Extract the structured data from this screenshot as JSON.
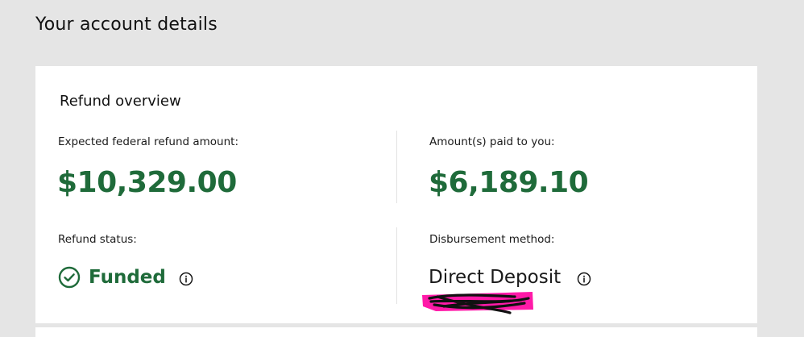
{
  "page": {
    "title": "Your account details"
  },
  "refund_overview": {
    "title": "Refund overview",
    "expected": {
      "label": "Expected federal refund amount:",
      "amount": "$10,329.00"
    },
    "paid": {
      "label": "Amount(s) paid to you:",
      "amount": "$6,189.10"
    },
    "status": {
      "label": "Refund status:",
      "value": "Funded",
      "icon": "check-circle-icon",
      "info_icon": "info-icon"
    },
    "disbursement": {
      "label": "Disbursement method:",
      "value": "Direct Deposit",
      "info_icon": "info-icon"
    }
  },
  "colors": {
    "page_background": "#e5e5e5",
    "card_background": "#ffffff",
    "amount_green": "#1f6b3a",
    "redaction_magenta": "#ff1aa8"
  }
}
